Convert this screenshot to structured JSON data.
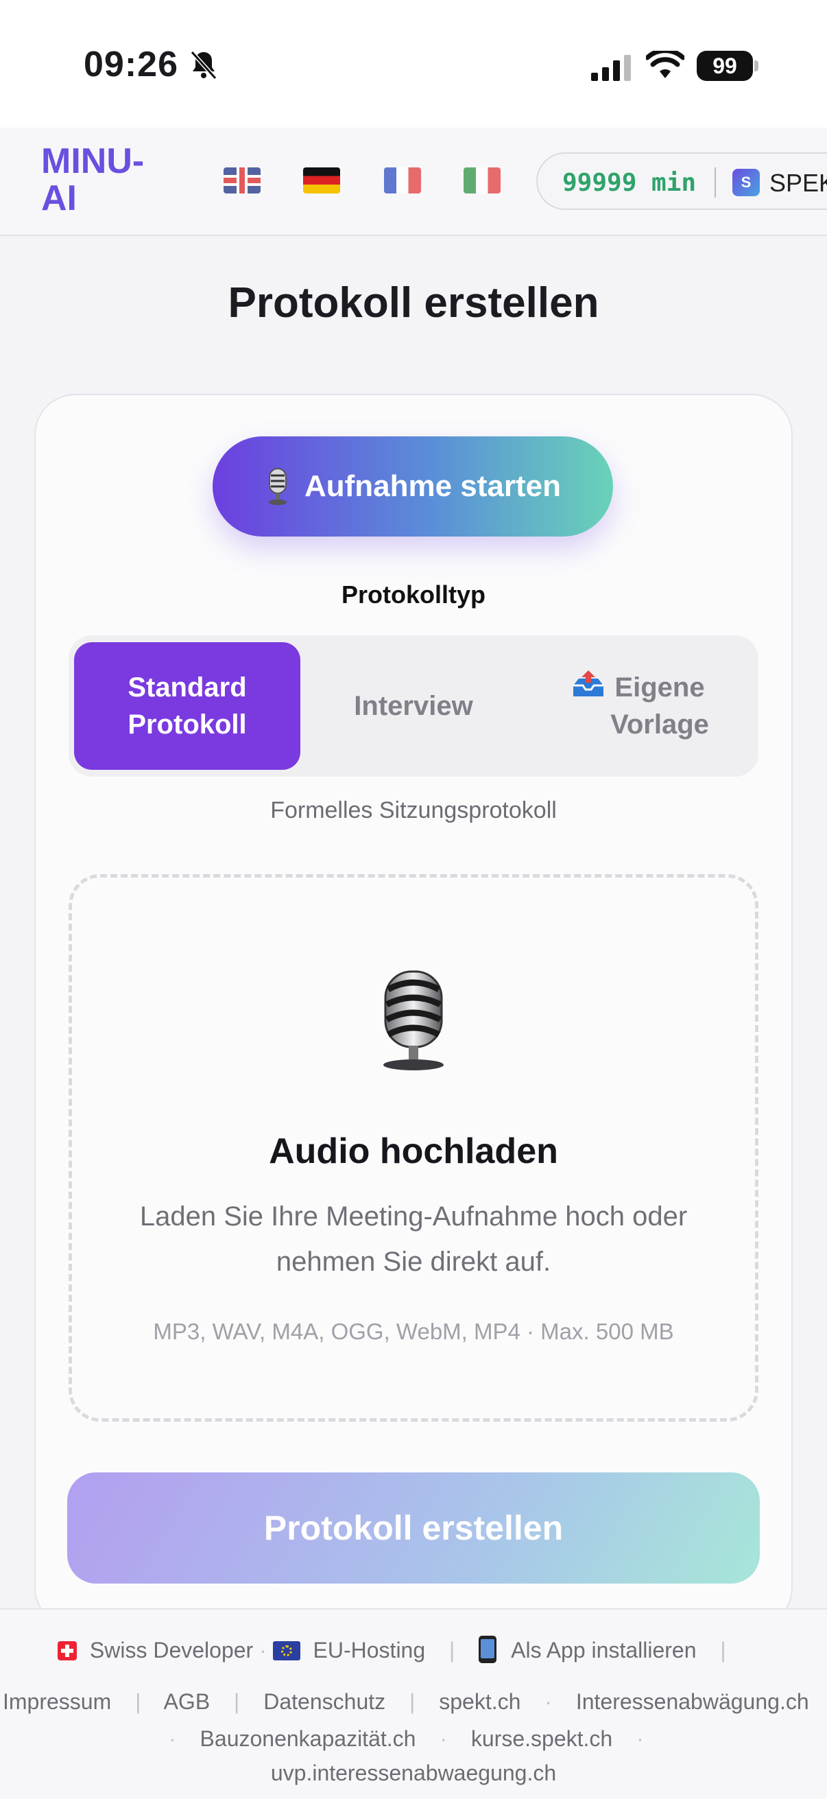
{
  "status_bar": {
    "time": "09:26",
    "battery": "99"
  },
  "header": {
    "logo": "MINU-\nAI",
    "languages": [
      "English",
      "Deutsch",
      "Français",
      "Italiano"
    ],
    "credits": "99999 min",
    "spekt_logo_letter": "S",
    "spekt_label": "SPEKT"
  },
  "page": {
    "title": "Protokoll erstellen"
  },
  "record_button": {
    "label": "Aufnahme starten"
  },
  "protocol_type": {
    "label": "Protokolltyp",
    "options": [
      "Standard\nProtokoll",
      "Interview",
      "Eigene\nVorlage"
    ],
    "selected": "Standard\nProtokoll",
    "description": "Formelles Sitzungsprotokoll"
  },
  "upload": {
    "title": "Audio hochladen",
    "description": "Laden Sie Ihre Meeting-Aufnahme hoch oder nehmen Sie direkt auf.",
    "formats": "MP3, WAV, M4A, OGG, WebM, MP4 · Max. 500 MB"
  },
  "create_button": {
    "label": "Protokoll erstellen"
  },
  "footer": {
    "swiss": "Swiss Developer",
    "eu": "EU-Hosting",
    "install": "Als App installieren",
    "links": [
      "Impressum",
      "AGB",
      "Datenschutz",
      "spekt.ch",
      "Interessenabwägung.ch",
      "Bauzonenkapazität.ch",
      "kurse.spekt.ch",
      "uvp.interessenabwaegung.ch"
    ]
  },
  "colors": {
    "accent": "#7a3ae0",
    "credits": "#2fa36b"
  }
}
